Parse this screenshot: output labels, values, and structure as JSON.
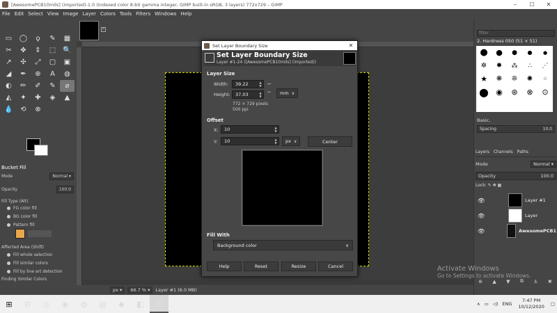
{
  "window": {
    "title": "[AwesomePCB10mils] (imported)-1.0 (Indexed color 8-bit gamma integer, GIMP built-in sRGB, 3 layers) 772x729 – GIMP",
    "minimize": "–",
    "maximize": "☐",
    "close": "✕"
  },
  "menu": [
    "File",
    "Edit",
    "Select",
    "View",
    "Image",
    "Layer",
    "Colors",
    "Tools",
    "Filters",
    "Windows",
    "Help"
  ],
  "toolbox": {
    "tools": [
      "▭",
      "◯",
      "ϙ",
      "✎",
      "▦",
      "✂",
      "✥",
      "⇕",
      "⬚",
      "🔍",
      "↗",
      "✣",
      "⤢",
      "▢",
      "▣",
      "◢",
      "✒",
      "⊕",
      "A",
      "◍",
      "◐",
      "✏",
      "✐",
      "✎",
      "⌀",
      "◭",
      "✦",
      "✚",
      "◈",
      "▲",
      "💧",
      "⟲",
      "⊗"
    ],
    "options_title": "Bucket Fill",
    "mode_label": "Mode",
    "mode_value": "Normal",
    "opacity_label": "Opacity",
    "opacity_value": "100.0",
    "fill_type_label": "Fill Type  (Alt)",
    "fill_options": [
      "FG color fill",
      "BG color fill",
      "Pattern fill"
    ],
    "affected_label": "Affected Area  (Shift)",
    "affected_options": [
      "Fill whole selection",
      "Fill similar colors",
      "Fill by line art detection"
    ],
    "finding_label": "Finding Similar Colors"
  },
  "status": {
    "unit": "px",
    "zoom": "66.7 %",
    "layer_info": "Layer #1 (6.0 MB)"
  },
  "dialog": {
    "title": "Set Layer Boundary Size",
    "close": "✕",
    "header_title": "Set Layer Boundary Size",
    "header_sub": "Layer #1-24 ([AwesomePCB10mils] (imported))",
    "layer_size_label": "Layer Size",
    "width_label": "Width:",
    "width_value": "39.22",
    "height_label": "Height:",
    "height_value": "37.03",
    "size_unit": "mm",
    "pixels_info": "772 × 729 pixels",
    "ppi_info": "500 ppi",
    "offset_label": "Offset",
    "x_label": "X:",
    "x_value": "10",
    "y_label": "Y:",
    "y_value": "10",
    "offset_unit": "px",
    "center_label": "Center",
    "fill_with_label": "Fill With",
    "fill_with_value": "Background color",
    "buttons": {
      "help": "Help",
      "reset": "Reset",
      "resize": "Resize",
      "cancel": "Cancel"
    }
  },
  "dock": {
    "filter_placeholder": "filter",
    "brush_name": "2. Hardness 050 (51 × 51)",
    "brushes": [
      "●",
      "●",
      "●",
      "●",
      "●",
      "✲",
      "✹",
      "⁂",
      "∴",
      "⋰",
      "★",
      "❋",
      "❊",
      "✺",
      "⁘",
      "⬤",
      "◉",
      "⊛",
      "⊗",
      "⊙"
    ],
    "preset_label": "Basic,",
    "spacing_label": "Spacing",
    "spacing_value": "10.0",
    "tabs": [
      "Layers",
      "Channels",
      "Paths"
    ],
    "mode_label": "Mode",
    "mode_value": "Normal",
    "opacity_label": "Opacity",
    "opacity_value": "100.0",
    "lock_label": "Lock:",
    "layers": [
      {
        "name": "Layer #1",
        "thumb": "#000000"
      },
      {
        "name": "Layer",
        "thumb": "#ffffff"
      },
      {
        "name": "AwesomePCB1",
        "thumb": "#111111"
      }
    ]
  },
  "watermark": {
    "line1": "Activate Windows",
    "line2": "Go to Settings to activate Windows."
  },
  "taskbar": {
    "start": "⊞",
    "icons": [
      "⊟",
      "◎",
      "◉",
      "◍",
      "▤",
      "◆",
      "◧",
      "▣"
    ],
    "tray_lang": "ENG",
    "time": "7:47 PM",
    "date": "10/12/2020"
  }
}
